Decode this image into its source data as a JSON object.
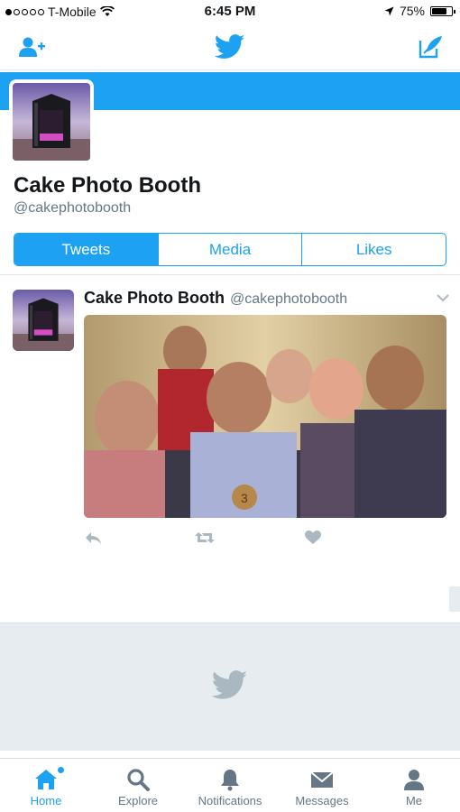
{
  "status_bar": {
    "carrier": "T-Mobile",
    "time": "6:45 PM",
    "battery": "75%",
    "battery_level": 0.75
  },
  "header": {
    "left_icon": "add-user-icon",
    "center_icon": "twitter-bird-icon",
    "right_icon": "compose-tweet-icon"
  },
  "profile": {
    "name": "Cake Photo Booth",
    "handle": "@cakephotobooth"
  },
  "tabs": [
    {
      "label": "Tweets",
      "active": true
    },
    {
      "label": "Media",
      "active": false
    },
    {
      "label": "Likes",
      "active": false
    }
  ],
  "tweet": {
    "name": "Cake Photo Booth",
    "handle": "@cakephotobooth",
    "actions": [
      "reply-icon",
      "retweet-icon",
      "like-icon"
    ]
  },
  "tab_bar": {
    "items": [
      {
        "label": "Home",
        "icon": "home-icon",
        "active": true
      },
      {
        "label": "Explore",
        "icon": "search-icon",
        "active": false
      },
      {
        "label": "Notifications",
        "icon": "bell-icon",
        "active": false
      },
      {
        "label": "Messages",
        "icon": "envelope-icon",
        "active": false
      },
      {
        "label": "Me",
        "icon": "person-icon",
        "active": false
      }
    ]
  },
  "colors": {
    "accent": "#1da1f2",
    "secondary_text": "#657786",
    "icon_gray": "#8899a6",
    "loading_bg": "#e6ecf0"
  }
}
